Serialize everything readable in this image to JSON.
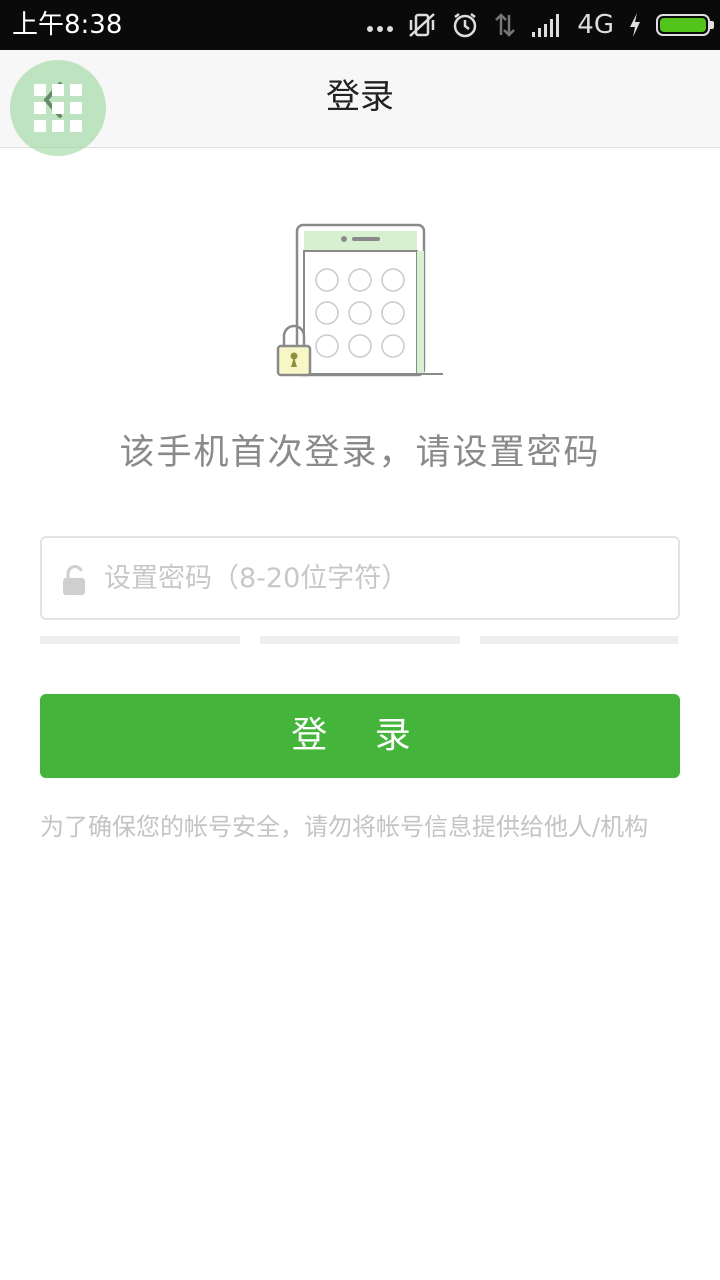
{
  "status_bar": {
    "time": "上午8:38",
    "network": "4G",
    "icons": [
      "more-dots-icon",
      "vibrate-off-icon",
      "alarm-icon",
      "data-arrows-icon",
      "signal-icon",
      "charging-icon",
      "battery-icon"
    ],
    "battery_level": 1.0,
    "battery_color": "#53c41a"
  },
  "header": {
    "title": "登录",
    "back_icon": "back-arrow-icon",
    "float_menu_icon": "grid-menu-icon"
  },
  "main": {
    "illustration_icon": "phone-lock-icon",
    "prompt": "该手机首次登录，请设置密码",
    "password": {
      "placeholder": "设置密码（8-20位字符）",
      "value": "",
      "icon": "unlock-icon"
    },
    "strength_levels": 3,
    "login_label": "登 录",
    "safety_note": "为了确保您的帐号安全，请勿将帐号信息提供给他人/机构"
  },
  "colors": {
    "accent": "#44b43a",
    "illustration_green": "#d7f0cf",
    "title_text": "#222222",
    "muted_text": "#8a8a8a"
  }
}
